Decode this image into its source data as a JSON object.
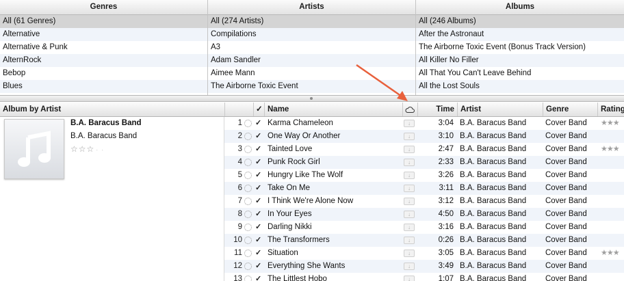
{
  "browser": {
    "genres": {
      "header": "Genres",
      "items": [
        "All (61 Genres)",
        "Alternative",
        "Alternative & Punk",
        "AlternRock",
        "Bebop",
        "Blues"
      ]
    },
    "artists": {
      "header": "Artists",
      "items": [
        "All (274 Artists)",
        "Compilations",
        "A3",
        "Adam Sandler",
        "Aimee Mann",
        "The Airborne Toxic Event"
      ]
    },
    "albums": {
      "header": "Albums",
      "items": [
        "All (246 Albums)",
        "After the Astronaut",
        "The Airborne Toxic Event (Bonus Track Version)",
        "All Killer No Filler",
        "All That You Can't Leave Behind",
        "All the Lost Souls"
      ]
    }
  },
  "columns": {
    "album_by_artist": "Album by Artist",
    "check": "✓",
    "name": "Name",
    "cloud_icon": "cloud-icon",
    "time": "Time",
    "artist": "Artist",
    "genre": "Genre",
    "rating": "Rating"
  },
  "album": {
    "title": "B.A. Baracus Band",
    "artist": "B.A. Baracus Band",
    "rating_stars": "☆☆☆",
    "rating_dots": "··"
  },
  "tracks": [
    {
      "num": "1",
      "checked": "✓",
      "name": "Karma Chameleon",
      "time": "3:04",
      "artist": "B.A. Baracus Band",
      "genre": "Cover Band",
      "rating": "★★★"
    },
    {
      "num": "2",
      "checked": "✓",
      "name": "One Way Or Another",
      "time": "3:10",
      "artist": "B.A. Baracus Band",
      "genre": "Cover Band",
      "rating": ""
    },
    {
      "num": "3",
      "checked": "✓",
      "name": "Tainted Love",
      "time": "2:47",
      "artist": "B.A. Baracus Band",
      "genre": "Cover Band",
      "rating": "★★★"
    },
    {
      "num": "4",
      "checked": "✓",
      "name": "Punk Rock Girl",
      "time": "2:33",
      "artist": "B.A. Baracus Band",
      "genre": "Cover Band",
      "rating": ""
    },
    {
      "num": "5",
      "checked": "✓",
      "name": "Hungry Like The Wolf",
      "time": "3:26",
      "artist": "B.A. Baracus Band",
      "genre": "Cover Band",
      "rating": ""
    },
    {
      "num": "6",
      "checked": "✓",
      "name": "Take On Me",
      "time": "3:11",
      "artist": "B.A. Baracus Band",
      "genre": "Cover Band",
      "rating": ""
    },
    {
      "num": "7",
      "checked": "✓",
      "name": "I Think We're Alone Now",
      "time": "3:12",
      "artist": "B.A. Baracus Band",
      "genre": "Cover Band",
      "rating": ""
    },
    {
      "num": "8",
      "checked": "✓",
      "name": "In Your Eyes",
      "time": "4:50",
      "artist": "B.A. Baracus Band",
      "genre": "Cover Band",
      "rating": ""
    },
    {
      "num": "9",
      "checked": "✓",
      "name": "Darling Nikki",
      "time": "3:16",
      "artist": "B.A. Baracus Band",
      "genre": "Cover Band",
      "rating": ""
    },
    {
      "num": "10",
      "checked": "✓",
      "name": "The Transformers",
      "time": "0:26",
      "artist": "B.A. Baracus Band",
      "genre": "Cover Band",
      "rating": ""
    },
    {
      "num": "11",
      "checked": "✓",
      "name": "Situation",
      "time": "3:05",
      "artist": "B.A. Baracus Band",
      "genre": "Cover Band",
      "rating": "★★★"
    },
    {
      "num": "12",
      "checked": "✓",
      "name": "Everything She Wants",
      "time": "3:49",
      "artist": "B.A. Baracus Band",
      "genre": "Cover Band",
      "rating": ""
    },
    {
      "num": "13",
      "checked": "✓",
      "name": "The Littlest Hobo",
      "time": "1:07",
      "artist": "B.A. Baracus Band",
      "genre": "Cover Band",
      "rating": ""
    }
  ],
  "annotation": {
    "arrow_color": "#e8603c"
  }
}
